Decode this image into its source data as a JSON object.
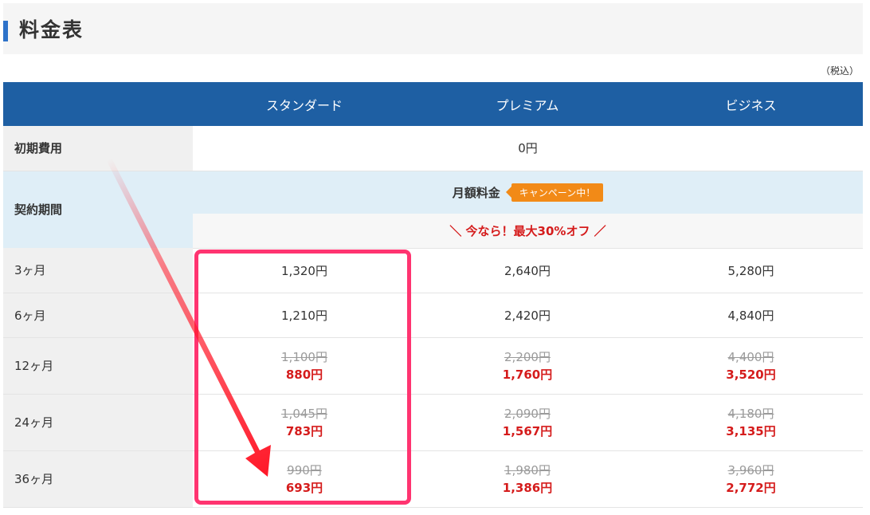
{
  "page": {
    "title": "料金表",
    "tax_note": "（税込）"
  },
  "table": {
    "plans": [
      "スタンダード",
      "プレミアム",
      "ビジネス"
    ],
    "initial_fee": {
      "label": "初期費用",
      "value": "0円"
    },
    "contract": {
      "label": "契約期間",
      "monthly_label": "月額料金",
      "campaign_badge": "キャンペーン中！",
      "promo": "＼ 今なら！最大30%オフ ／"
    },
    "rows": [
      {
        "label": "3ヶ月",
        "cells": [
          {
            "price": "1,320円"
          },
          {
            "price": "2,640円"
          },
          {
            "price": "5,280円"
          }
        ]
      },
      {
        "label": "6ヶ月",
        "cells": [
          {
            "price": "1,210円"
          },
          {
            "price": "2,420円"
          },
          {
            "price": "4,840円"
          }
        ]
      },
      {
        "label": "12ヶ月",
        "cells": [
          {
            "old": "1,100円",
            "new": "880円"
          },
          {
            "old": "2,200円",
            "new": "1,760円"
          },
          {
            "old": "4,400円",
            "new": "3,520円"
          }
        ]
      },
      {
        "label": "24ヶ月",
        "cells": [
          {
            "old": "1,045円",
            "new": "783円"
          },
          {
            "old": "2,090円",
            "new": "1,567円"
          },
          {
            "old": "4,180円",
            "new": "3,135円"
          }
        ]
      },
      {
        "label": "36ヶ月",
        "cells": [
          {
            "old": "990円",
            "new": "693円"
          },
          {
            "old": "1,980円",
            "new": "1,386円"
          },
          {
            "old": "3,960円",
            "new": "2,772円"
          }
        ]
      }
    ]
  },
  "colors": {
    "header_bg": "#1e5fa3",
    "accent_blue": "#2d72c9",
    "discount_red": "#d51c1c",
    "campaign_orange": "#f28a17",
    "highlight_pink": "#ff3470",
    "arrow_red": "#ff1a2a"
  },
  "annotations": {
    "highlight_box": "annotation-highlight",
    "arrow": "annotation-arrow"
  }
}
